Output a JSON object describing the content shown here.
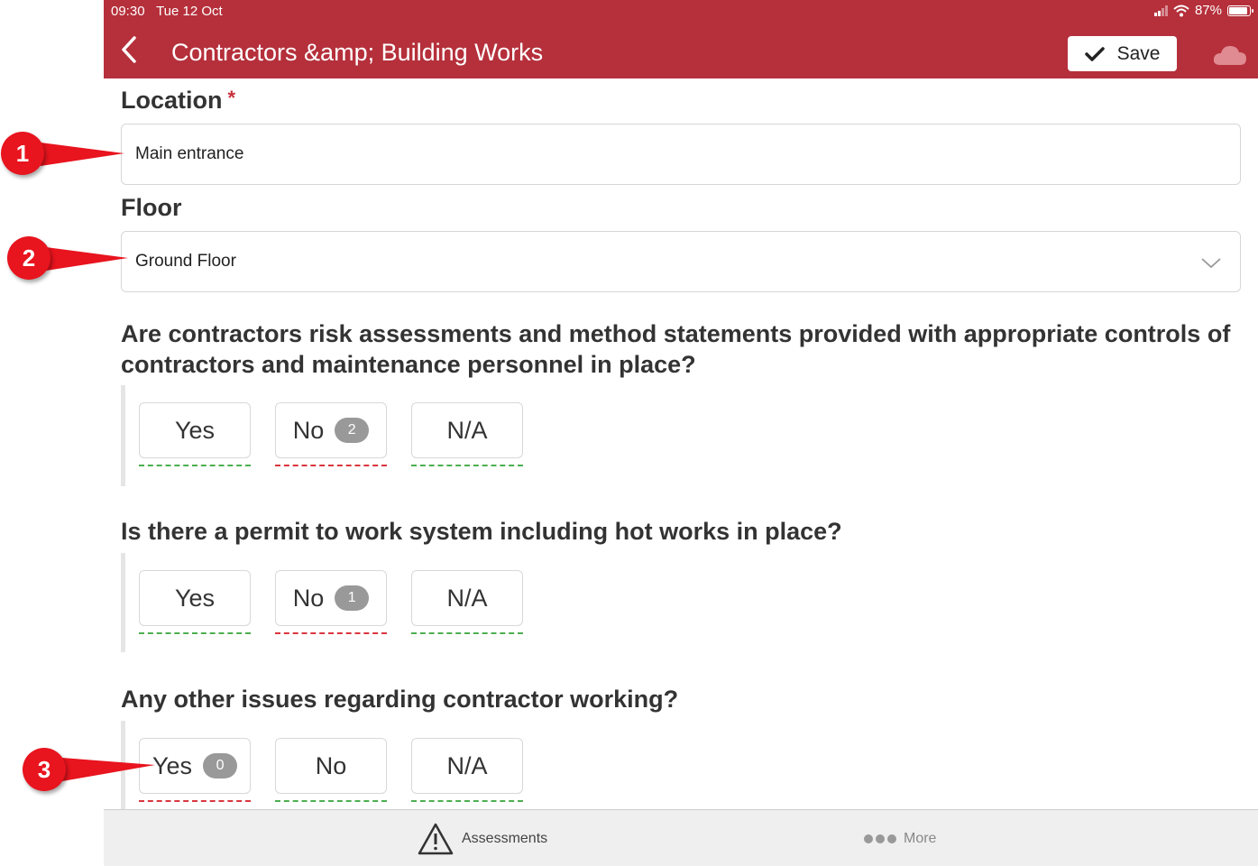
{
  "status_bar": {
    "time": "09:30",
    "date": "Tue 12 Oct",
    "battery": "87%"
  },
  "header": {
    "title": "Contractors &amp; Building Works",
    "save_label": "Save"
  },
  "location": {
    "label": "Location",
    "required_mark": "*",
    "value": "Main entrance"
  },
  "floor": {
    "label": "Floor",
    "value": "Ground Floor"
  },
  "questions": [
    {
      "text": "Are contractors risk assessments and method statements provided with appropriate controls of contractors and maintenance personnel in place?",
      "options": {
        "yes": "Yes",
        "no": "No",
        "na": "N/A",
        "no_badge": "2"
      }
    },
    {
      "text": "Is there a permit to work system including hot works in place?",
      "options": {
        "yes": "Yes",
        "no": "No",
        "na": "N/A",
        "no_badge": "1"
      }
    },
    {
      "text": "Any other issues regarding contractor working?",
      "options": {
        "yes": "Yes",
        "no": "No",
        "na": "N/A",
        "yes_badge": "0"
      }
    }
  ],
  "tabbar": {
    "assessments_label": "Assessments",
    "more_label": "More"
  },
  "callouts": [
    "1",
    "2",
    "3"
  ],
  "colors": {
    "brand": "#b5303b",
    "accept_line": "#4caf50",
    "reject_line": "#d9363e",
    "callout": "#e8141e"
  },
  "icons": [
    "chevron-left-icon",
    "check-icon",
    "cloud-icon",
    "chevron-down-icon",
    "warning-triangle-icon",
    "more-dots-icon"
  ]
}
